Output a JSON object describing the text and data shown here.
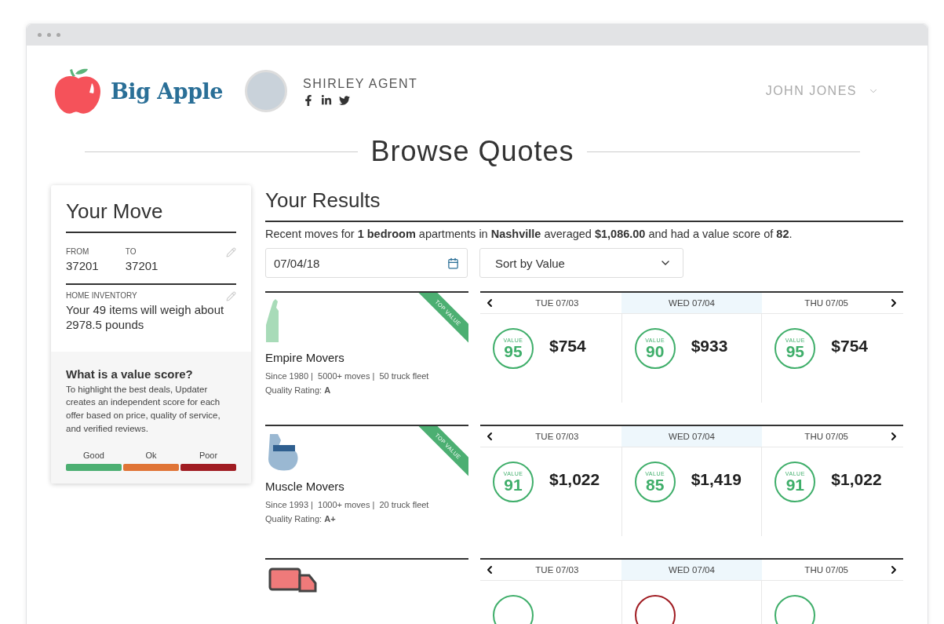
{
  "header": {
    "brand": "Big Apple",
    "agent": {
      "name": "SHIRLEY AGENT"
    },
    "user": {
      "name": "JOHN JONES"
    }
  },
  "page_title": "Browse Quotes",
  "your_move": {
    "title": "Your Move",
    "from_label": "FROM",
    "from": "37201",
    "to_label": "TO",
    "to": "37201",
    "inventory_label": "HOME INVENTORY",
    "inventory": "Your 49 items will weigh about 2978.5 pounds",
    "info_title": "What is a value score?",
    "info_text": "To highlight the best deals, Updater creates an independent score for each offer based on price, quality of service, and verified reviews.",
    "scale": [
      {
        "label": "Good",
        "color": "#4caf72"
      },
      {
        "label": "Ok",
        "color": "#e07436"
      },
      {
        "label": "Poor",
        "color": "#a01c22"
      }
    ]
  },
  "results": {
    "title": "Your Results",
    "summary": "Recent moves for **1 bedroom** apartments in **Nashville** averaged **$1,086.00** and had a value score of **82**.",
    "date": "07/04/18",
    "sort": "Sort by Value"
  },
  "movers": [
    {
      "kind": "statue",
      "name": "Empire Movers",
      "details": "Since 1980 |  5000+ moves |  50 truck fleet",
      "rating": "Quality Rating: **A**",
      "ribbon": "TOP VALUE",
      "days": [
        {
          "label": "TUE 07/03",
          "selected": false,
          "score_label": "VALUE",
          "score": "95",
          "price": "$754",
          "color": "#3fae6a"
        },
        {
          "label": "WED 07/04",
          "selected": true,
          "score_label": "VALUE",
          "score": "90",
          "price": "$933",
          "color": "#3fae6a"
        },
        {
          "label": "THU 07/05",
          "selected": false,
          "score_label": "VALUE",
          "score": "95",
          "price": "$754",
          "color": "#3fae6a"
        }
      ]
    },
    {
      "kind": "arm",
      "name": "Muscle Movers",
      "details": "Since 1993 |  1000+ moves |  20 truck fleet",
      "rating": "Quality Rating: **A+**",
      "ribbon": "TOP VALUE",
      "days": [
        {
          "label": "TUE 07/03",
          "selected": false,
          "score_label": "VALUE",
          "score": "91",
          "price": "$1,022",
          "color": "#3fae6a"
        },
        {
          "label": "WED 07/04",
          "selected": true,
          "score_label": "VALUE",
          "score": "85",
          "price": "$1,419",
          "color": "#3fae6a"
        },
        {
          "label": "THU 07/05",
          "selected": false,
          "score_label": "VALUE",
          "score": "91",
          "price": "$1,022",
          "color": "#3fae6a"
        }
      ]
    },
    {
      "kind": "truck",
      "days": [
        {
          "label": "TUE 07/03",
          "selected": false,
          "color": "#3fae6a"
        },
        {
          "label": "WED 07/04",
          "selected": true,
          "color": "#a01c22"
        },
        {
          "label": "THU 07/05",
          "selected": false,
          "color": "#3fae6a"
        }
      ]
    }
  ]
}
